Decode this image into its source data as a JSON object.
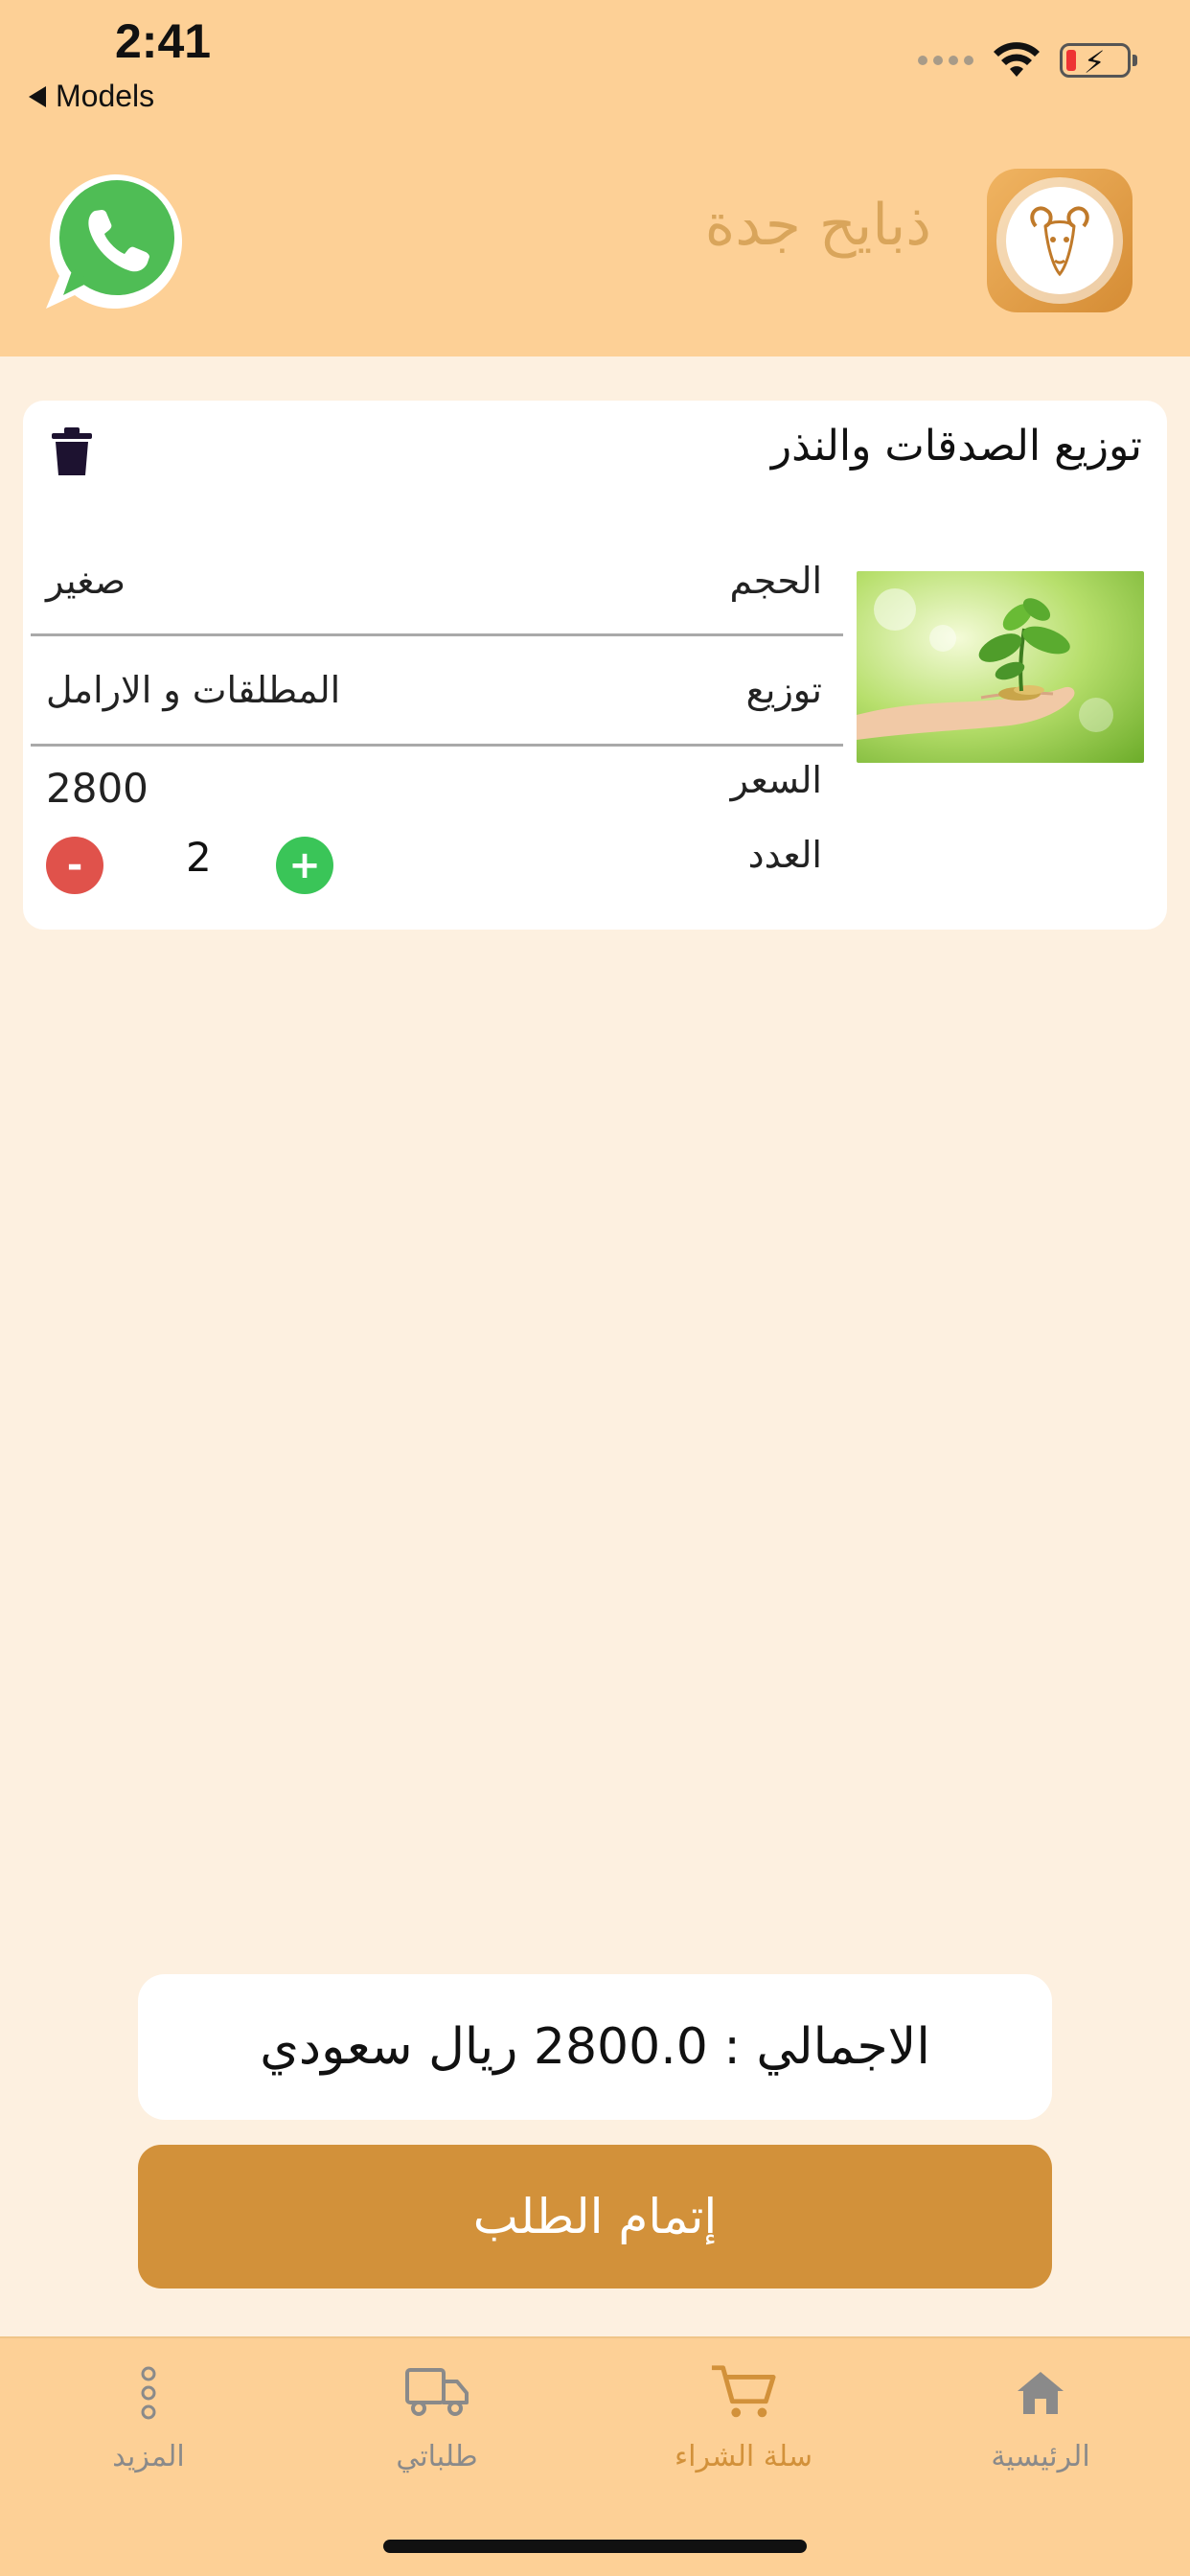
{
  "status_bar": {
    "time": "2:41",
    "back_label": "Models"
  },
  "header": {
    "app_title": "ذبايح جدة",
    "logo_icon": "ram-head-logo",
    "whatsapp_icon": "whatsapp-icon"
  },
  "cart_item": {
    "title": "توزيع الصدقات والنذر",
    "image": "hand-holding-plant-coins",
    "rows": {
      "size_label": "الحجم",
      "size_value": "صغير",
      "distribution_label": "توزيع",
      "distribution_value": "المطلقات و الارامل",
      "price_label": "السعر",
      "price_value": "2800",
      "quantity_label": "العدد",
      "quantity_value": "2"
    },
    "minus_label": "-",
    "plus_label": "+"
  },
  "total": {
    "text": "الاجمالي : 2800.0 ريال سعودي"
  },
  "checkout": {
    "label": "إتمام الطلب"
  },
  "tabbar": {
    "tabs": [
      {
        "label": "الرئيسية",
        "icon": "home-icon",
        "active": false
      },
      {
        "label": "سلة الشراء",
        "icon": "cart-icon",
        "active": true
      },
      {
        "label": "طلباتي",
        "icon": "truck-icon",
        "active": false
      },
      {
        "label": "المزيد",
        "icon": "more-icon",
        "active": false
      }
    ]
  },
  "colors": {
    "header_bg": "#fdd096",
    "page_bg": "#fdf0e0",
    "accent": "#d2913a",
    "minus": "#e0524b",
    "plus": "#3ac558"
  }
}
